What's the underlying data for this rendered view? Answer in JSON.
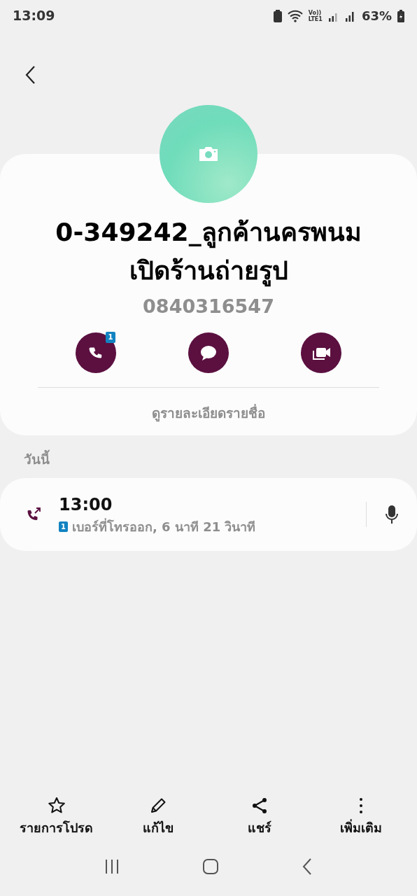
{
  "status_bar": {
    "time": "13:09",
    "network": "Vo))\nLTE1",
    "battery": "63%"
  },
  "contact": {
    "name_lines": [
      "0-349242_ลูกค้านครพนม",
      "เปิดร้านถ่ายรูป"
    ],
    "phone": "0840316547",
    "actions": [
      {
        "kind": "call",
        "sim": "1"
      },
      {
        "kind": "message"
      },
      {
        "kind": "video"
      }
    ],
    "details_link": "ดูรายละเอียดรายชื่อ"
  },
  "history": {
    "section": "วันนี้",
    "calls": [
      {
        "time": "13:00",
        "sim": "1",
        "detail": "เบอร์ที่โทรออก, 6 นาที 21 วินาที"
      }
    ]
  },
  "bottom_actions": [
    {
      "kind": "favorite",
      "label": "รายการโปรด"
    },
    {
      "kind": "edit",
      "label": "แก้ไข"
    },
    {
      "kind": "share",
      "label": "แชร์"
    },
    {
      "kind": "more",
      "label": "เพิ่มเติม"
    }
  ]
}
